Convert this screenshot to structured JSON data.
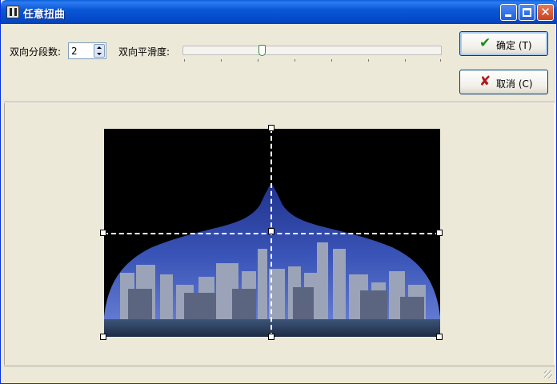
{
  "window": {
    "title": "任意扭曲"
  },
  "controls": {
    "segments_label": "双向分段数:",
    "segments_value": "2",
    "smoothness_label": "双向平滑度:",
    "smoothness_level": 0.3
  },
  "buttons": {
    "ok_label": "确定",
    "ok_shortcut": "(T)",
    "cancel_label": "取消",
    "cancel_shortcut": "(C)"
  },
  "colors": {
    "title_bar": "#0a58d6",
    "dialog_bg": "#ece9d8",
    "ok_icon": "#1a8a1a",
    "cancel_icon": "#b01818"
  },
  "icons": [
    "app-icon",
    "minimize-icon",
    "maximize-icon",
    "close-icon",
    "checkmark-icon",
    "x-icon",
    "resize-grip-icon"
  ]
}
